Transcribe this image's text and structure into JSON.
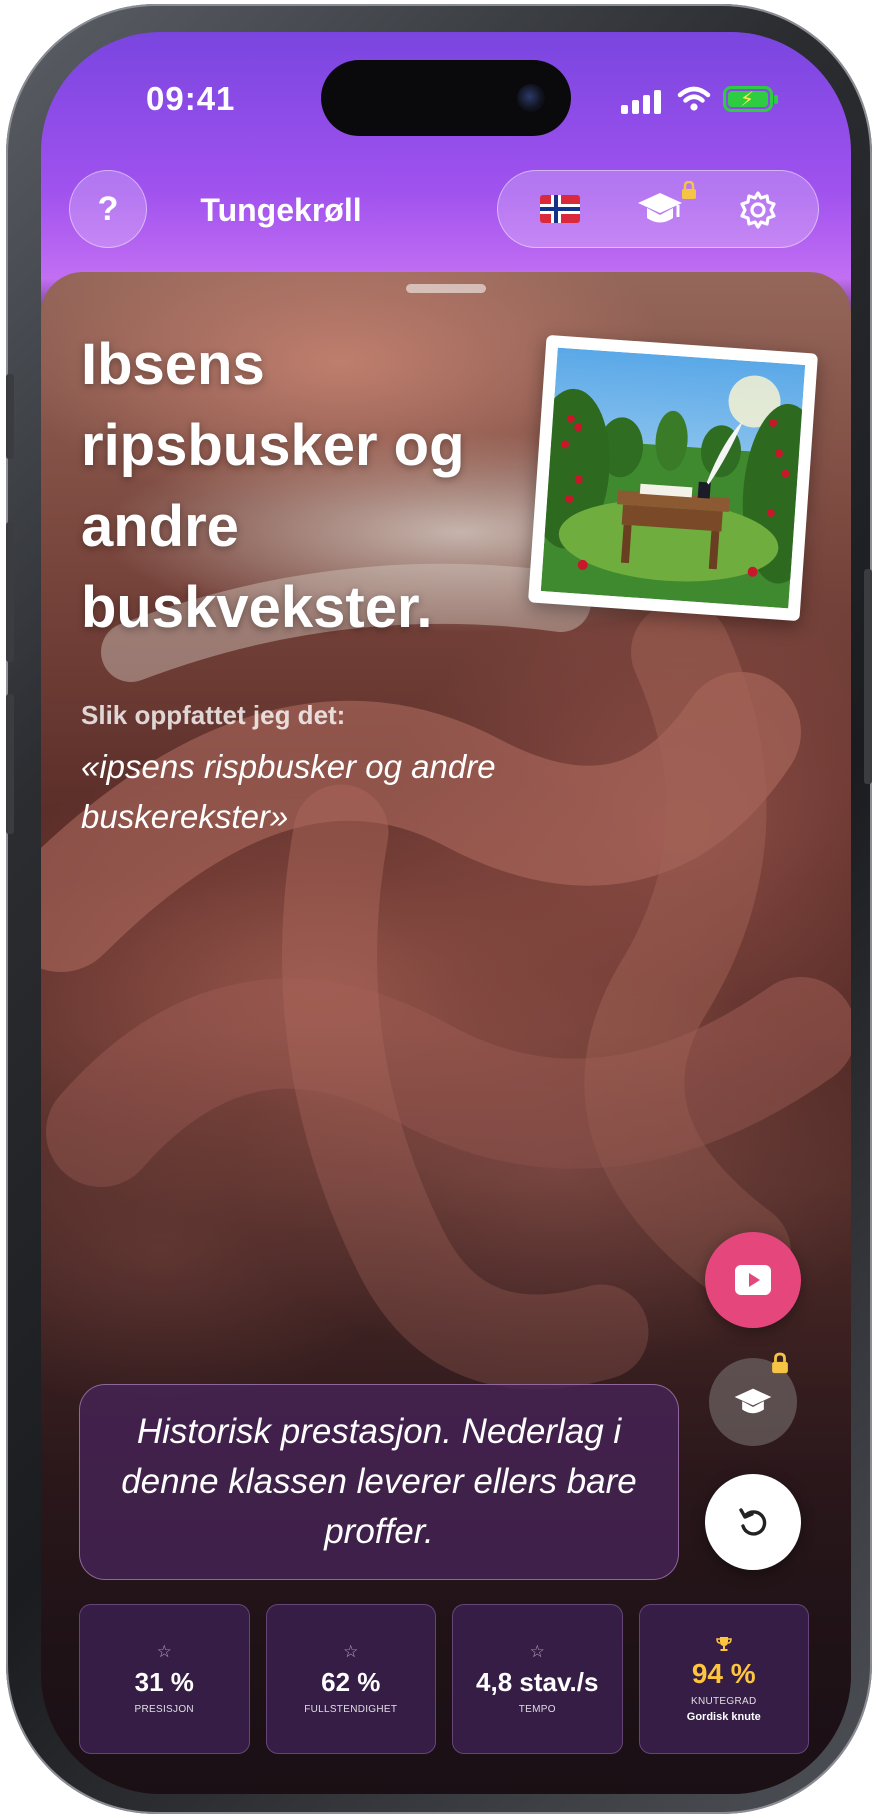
{
  "status": {
    "time": "09:41"
  },
  "header": {
    "help_label": "?",
    "title": "Tungekrøll",
    "language_icon": "norway-flag-icon",
    "learn_icon": "graduation-cap-icon",
    "settings_icon": "gear-icon"
  },
  "phrase": {
    "title": "Ibsens ripsbusker og andre buskvekster.",
    "heard_label": "Slik oppfattet jeg det:",
    "heard_text": "«ipsens rispbusker og andre buskerekster»"
  },
  "feedback": {
    "message": "Historisk prestasjon. Nederlag i denne klassen leverer ellers bare proffer."
  },
  "stats": [
    {
      "icon": "☆",
      "value": "31 %",
      "label": "PRESISJON"
    },
    {
      "icon": "☆",
      "value": "62 %",
      "label": "FULLSTENDIGHET"
    },
    {
      "icon": "☆",
      "value": "4,8 stav./s",
      "label": "TEMPO"
    },
    {
      "icon": "trophy-icon",
      "value": "94 %",
      "label": "KNUTEGRAD",
      "sub": "Gordisk knute"
    }
  ],
  "colors": {
    "accent": "#e5477c",
    "header_gradient_top": "#7a45e0",
    "header_gradient_bottom": "#c26ff3",
    "gold": "#ffc53d",
    "card": "#371e4b"
  }
}
